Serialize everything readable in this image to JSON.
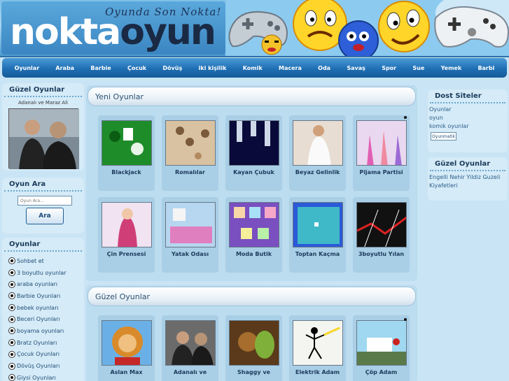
{
  "header": {
    "logo_white": "nokta",
    "logo_dark": "oyun",
    "slogan": "Oyunda Son Nokta!"
  },
  "nav": [
    "Oyunlar",
    "Araba",
    "Barbie",
    "Çocuk",
    "Dövüş",
    "iki kişilik",
    "Komik",
    "Macera",
    "Oda",
    "Savaş",
    "Spor",
    "Sue",
    "Yemek",
    "Barbi"
  ],
  "left": {
    "featured": {
      "title": "Güzel Oyunlar",
      "game_name": "Adanalı ve Maraz Ali"
    },
    "search": {
      "title": "Oyun Ara",
      "placeholder": "Oyun Ara...",
      "button": "Ara"
    },
    "categories": {
      "title": "Oyunlar",
      "items": [
        "Sohbet et",
        "3 boyutlu oyunlar",
        "araba oyunları",
        "Barbie Oyunları",
        "bebek oyunları",
        "Beceri Oyunları",
        "boyama oyunları",
        "Bratz Oyunları",
        "Çocuk Oyunları",
        "Dövüş Oyunları",
        "Giysi Oyunları"
      ]
    }
  },
  "right": {
    "friends": {
      "title": "Dost Siteler",
      "links": [
        "Oyunlar",
        "oyun",
        "komik oyunlar"
      ],
      "button": "Oyunmatik"
    },
    "good": {
      "title": "Güzel Oyunlar",
      "text": "Engelli Nehir Yildiz Guzeli Kiyafetleri"
    }
  },
  "new_games": {
    "title": "Yeni Oyunlar",
    "row1": [
      "Blackjack",
      "Romalılar",
      "Kayan Çubuk",
      "Beyaz Gelinlik",
      "Pijama Partisi"
    ],
    "row2": [
      "Çin Prensesi",
      "Yatak Odası",
      "Moda Butik",
      "Toptan Kaçma",
      "3boyutlu Yılan"
    ]
  },
  "good_games": {
    "title": "Güzel Oyunlar",
    "row1": [
      "Aslan Max",
      "Adanalı ve",
      "Shaggy ve",
      "Elektrik Adam",
      "Çöp Adam"
    ]
  },
  "colors": {
    "nav_blue": "#1f6fb4",
    "page_bg": "#c9e4f5",
    "panel_bg": "#d5ebf7",
    "card_bg": "#a9cfe6"
  }
}
